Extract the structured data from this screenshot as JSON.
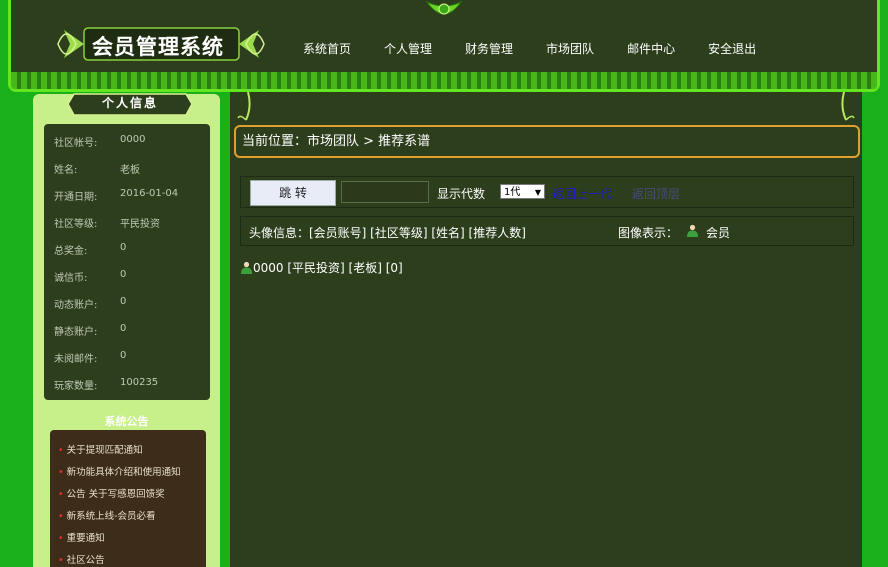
{
  "header": {
    "logo_title": "会员管理系统",
    "nav": [
      "系统首页",
      "个人管理",
      "财务管理",
      "市场团队",
      "邮件中心",
      "安全退出"
    ]
  },
  "profile": {
    "title": "个人信息",
    "rows": [
      {
        "k": "社区帐号:",
        "v": "0000"
      },
      {
        "k": "姓名:",
        "v": "老板"
      },
      {
        "k": "开通日期:",
        "v": "2016-01-04"
      },
      {
        "k": "社区等级:",
        "v": "平民投资"
      },
      {
        "k": "总奖金:",
        "v": "0"
      },
      {
        "k": "诚信币:",
        "v": "0"
      },
      {
        "k": "动态账户:",
        "v": "0"
      },
      {
        "k": "静态账户:",
        "v": "0"
      },
      {
        "k": "未阅邮件:",
        "v": "0"
      },
      {
        "k": "玩家数量:",
        "v": "100235"
      }
    ]
  },
  "notices": {
    "title": "系统公告",
    "items": [
      "关于提现匹配通知",
      "新功能具体介绍和使用通知",
      "公告 关于写感恩回馈奖",
      "新系统上线-会员必看",
      "重要通知",
      "社区公告"
    ]
  },
  "main": {
    "breadcrumb": "当前位置：市场团队 > 推荐系谱",
    "jump_label": "跳 转",
    "jump_value": "",
    "gen_label": "显示代数",
    "gen_selected": "1代",
    "back_one": "返回上一代",
    "back_top": "返回顶层",
    "legend_text": "头像信息：[会员账号] [社区等级] [姓名] [推荐人数]",
    "legend_right": "图像表示：",
    "legend_member": "会员",
    "node": "0000 [平民投资] [老板] [0]"
  },
  "colors": {
    "accent": "#63e51f",
    "panel": "#2d3e1c",
    "link": "#1b1bc8",
    "border": "#e0a030"
  }
}
